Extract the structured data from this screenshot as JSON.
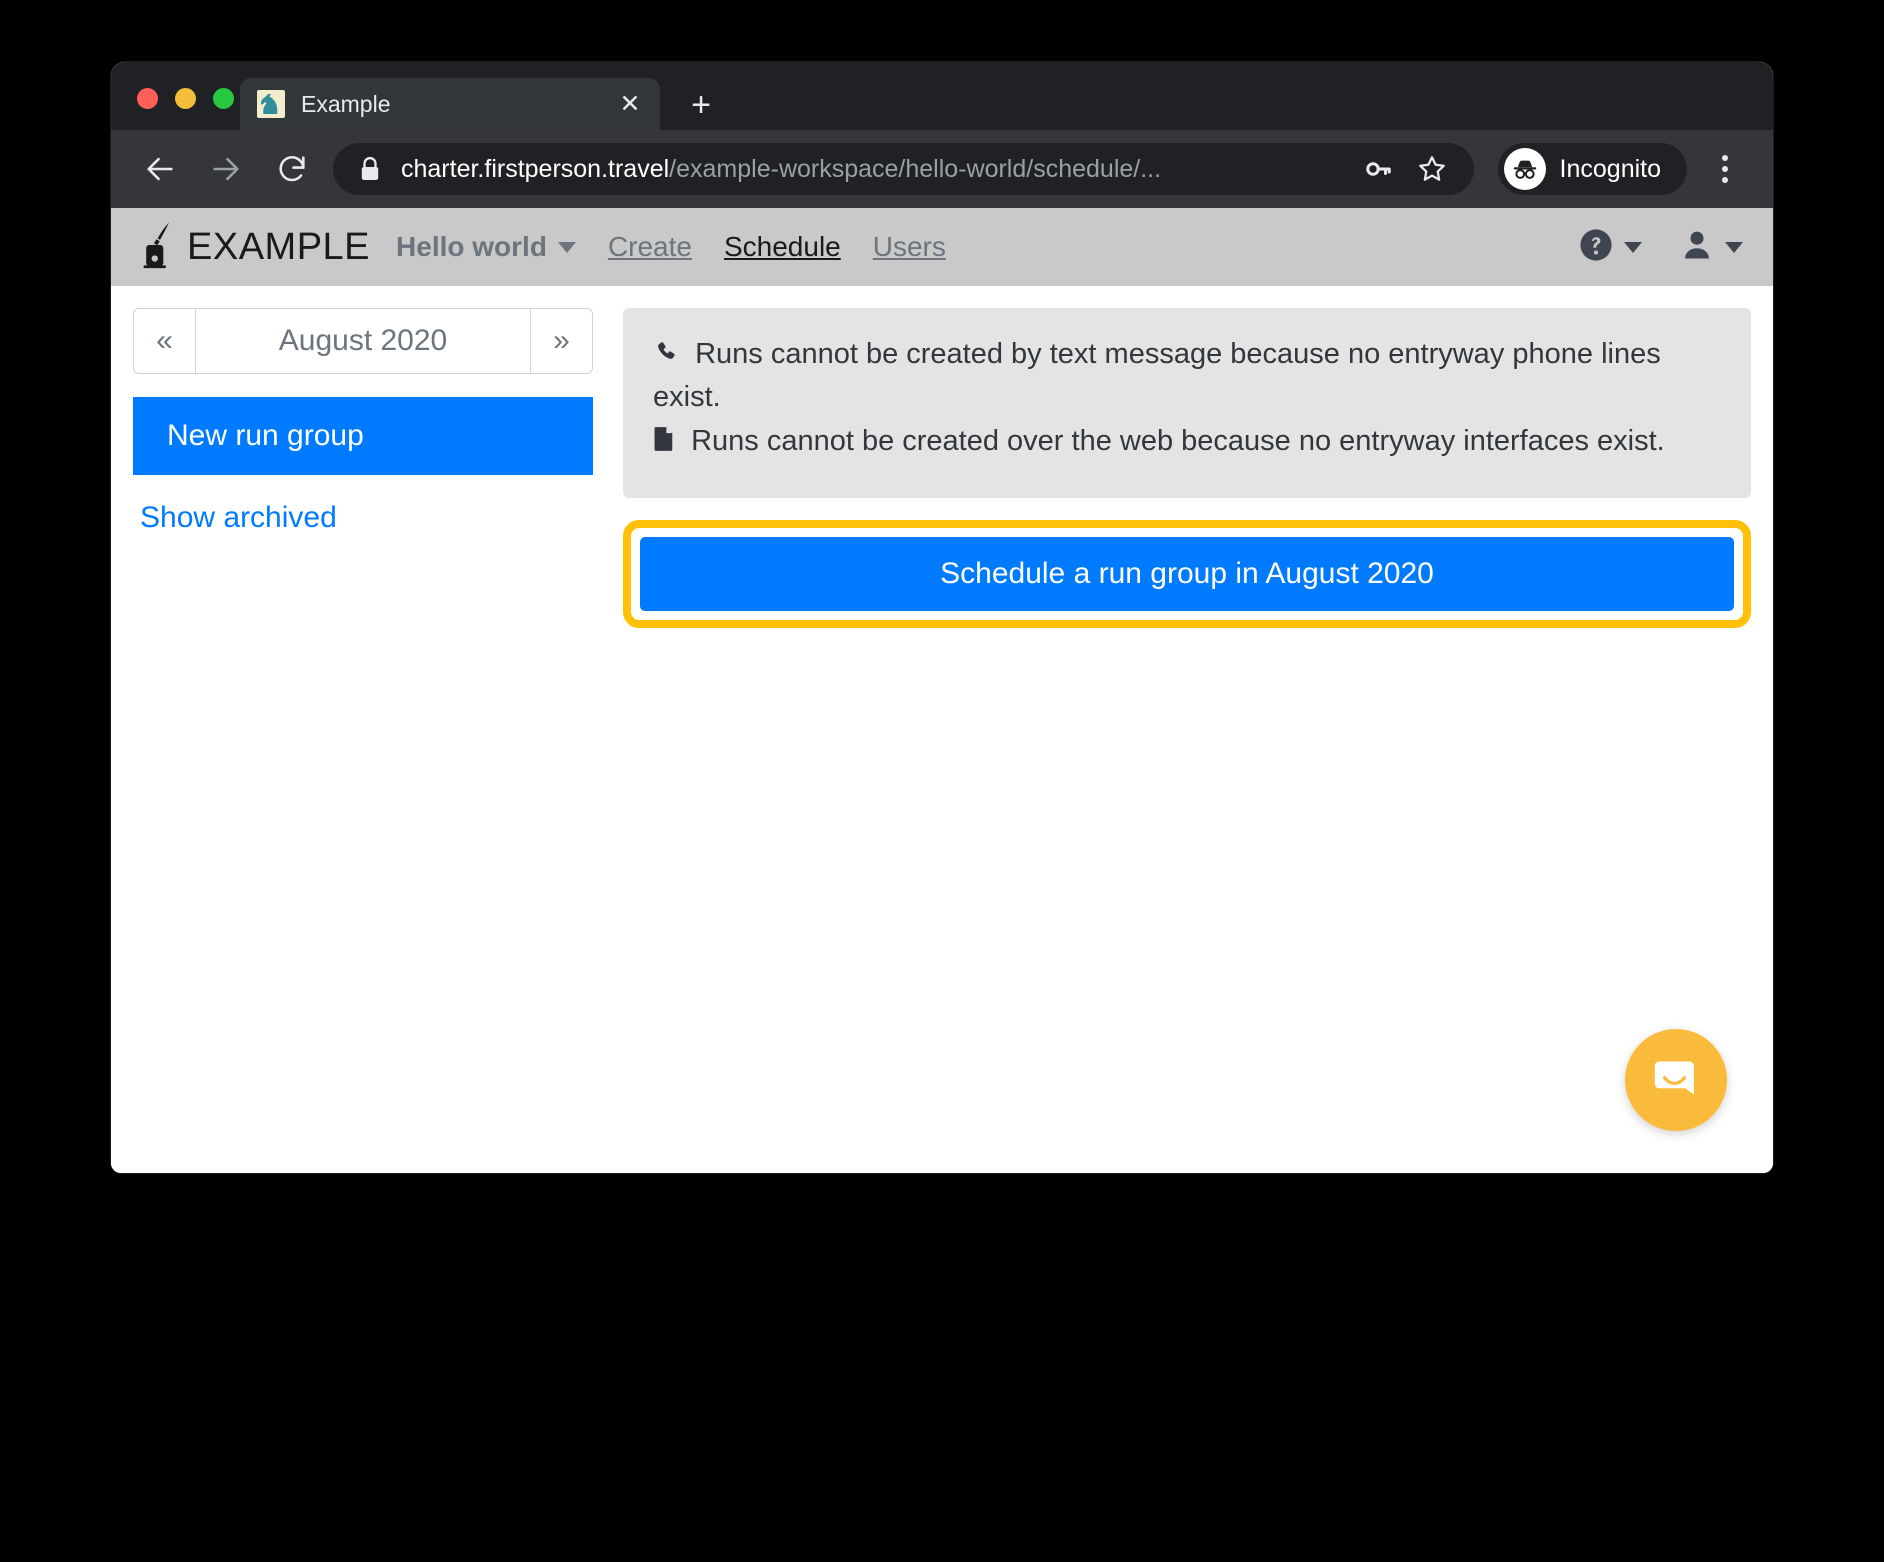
{
  "browser": {
    "tab": {
      "title": "Example",
      "favicon": "chess-knight-icon",
      "close_label": "✕"
    },
    "new_tab_label": "+",
    "toolbar": {
      "back_icon": "arrow-left-icon",
      "forward_icon": "arrow-right-icon",
      "reload_icon": "reload-icon",
      "lock_icon": "lock-icon",
      "url_host": "charter.firstperson.travel",
      "url_path": "/example-workspace/hello-world/schedule/...",
      "key_icon": "key-icon",
      "star_icon": "star-icon",
      "profile_label": "Incognito",
      "profile_icon": "incognito-icon",
      "menu_icon": "three-dots-icon"
    }
  },
  "app": {
    "navbar": {
      "brand": "EXAMPLE",
      "brand_icon": "inkwell-quill-icon",
      "workspace": "Hello world",
      "links": [
        {
          "label": "Create",
          "active": false
        },
        {
          "label": "Schedule",
          "active": true
        },
        {
          "label": "Users",
          "active": false
        }
      ],
      "help_icon": "question-circle-icon",
      "account_icon": "user-icon"
    },
    "sidebar": {
      "prev_month_label": "«",
      "month_label": "August 2020",
      "next_month_label": "»",
      "new_run_group_label": "New run group",
      "show_archived_label": "Show archived"
    },
    "main": {
      "alert": {
        "lines": [
          {
            "icon": "phone-icon",
            "text": "Runs cannot be created by text message because no entryway phone lines exist."
          },
          {
            "icon": "file-icon",
            "text": "Runs cannot be created over the web because no entryway interfaces exist."
          }
        ]
      },
      "cta_label": "Schedule a run group in August 2020"
    },
    "chat_launcher_icon": "chat-bubble-icon"
  },
  "colors": {
    "primary_blue": "#007bff",
    "highlight_yellow": "#ffc107",
    "navbar_grey": "#c9c9c9",
    "alert_grey": "#e4e4e4",
    "chat_yellow": "#fabb3c"
  }
}
